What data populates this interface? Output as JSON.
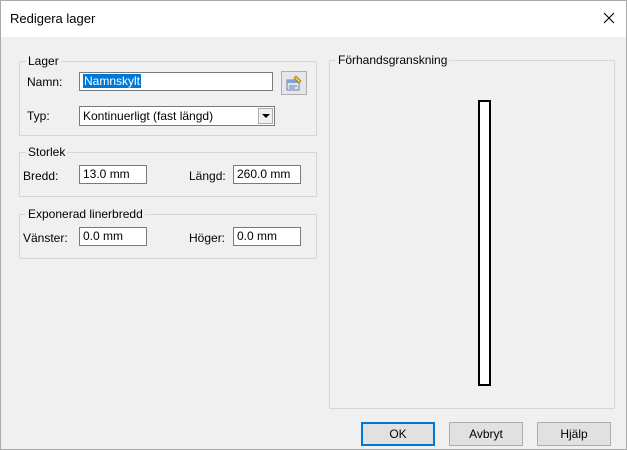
{
  "window": {
    "title": "Redigera lager"
  },
  "lager": {
    "group_label": "Lager",
    "name_label": "Namn:",
    "name_value": "Namnskylt",
    "type_label": "Typ:",
    "type_value": "Kontinuerligt (fast längd)"
  },
  "storlek": {
    "group_label": "Storlek",
    "width_label": "Bredd:",
    "width_value": "13.0 mm",
    "length_label": "Längd:",
    "length_value": "260.0 mm"
  },
  "exponerad": {
    "group_label": "Exponerad linerbredd",
    "left_label": "Vänster:",
    "left_value": "0.0 mm",
    "right_label": "Höger:",
    "right_value": "0.0 mm"
  },
  "preview": {
    "group_label": "Förhandsgranskning"
  },
  "buttons": {
    "ok": "OK",
    "cancel": "Avbryt",
    "help": "Hjälp"
  }
}
